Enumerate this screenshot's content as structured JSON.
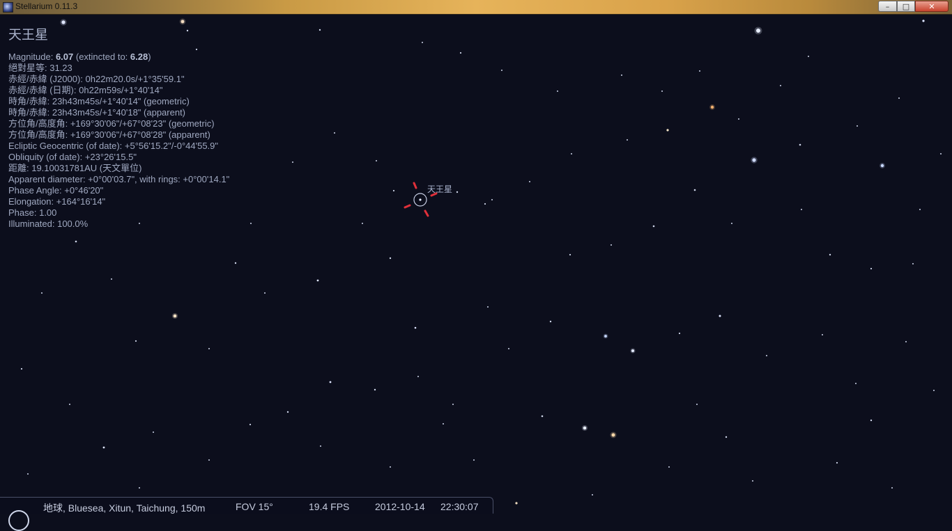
{
  "window": {
    "title": "Stellarium 0.11.3",
    "minimize_glyph": "–",
    "maximize_glyph": "□",
    "close_glyph": "✕"
  },
  "object_info": {
    "name": "天王星",
    "magnitude_label": "Magnitude: ",
    "magnitude_value": "6.07",
    "extincted_label": " (extincted to: ",
    "extincted_value": "6.28",
    "extincted_close": ")",
    "lines": [
      "絕對星等: 31.23",
      "赤經/赤緯 (J2000): 0h22m20.0s/+1°35'59.1\"",
      "赤經/赤緯 (日期): 0h22m59s/+1°40'14\"",
      "時角/赤緯: 23h43m45s/+1°40'14\" (geometric)",
      "時角/赤緯: 23h43m45s/+1°40'18\" (apparent)",
      "方位角/高度角: +169°30'06\"/+67°08'23\" (geometric)",
      "方位角/高度角: +169°30'06\"/+67°08'28\" (apparent)",
      "Ecliptic Geocentric (of date): +5°56'15.2\"/-0°44'55.9\"",
      "Obliquity (of date): +23°26'15.5\"",
      "距離: 19.10031781AU (天文單位)",
      "Apparent diameter: +0°00'03.7\", with rings: +0°00'14.1\"",
      "Phase Angle: +0°46'20\"",
      "Elongation: +164°16'14\"",
      "Phase: 1.00",
      "Illuminated: 100.0%"
    ]
  },
  "target": {
    "label": "天王星",
    "marker_color": "#e0303a"
  },
  "statusbar": {
    "location": "地球, Bluesea, Xitun, Taichung, 150m",
    "fov": "FOV 15°",
    "fps": "19.4 FPS",
    "date": "2012-10-14",
    "time": "22:30:07"
  },
  "colors": {
    "sky": "#0c0e1c",
    "info_text": "#9fa8c0"
  }
}
